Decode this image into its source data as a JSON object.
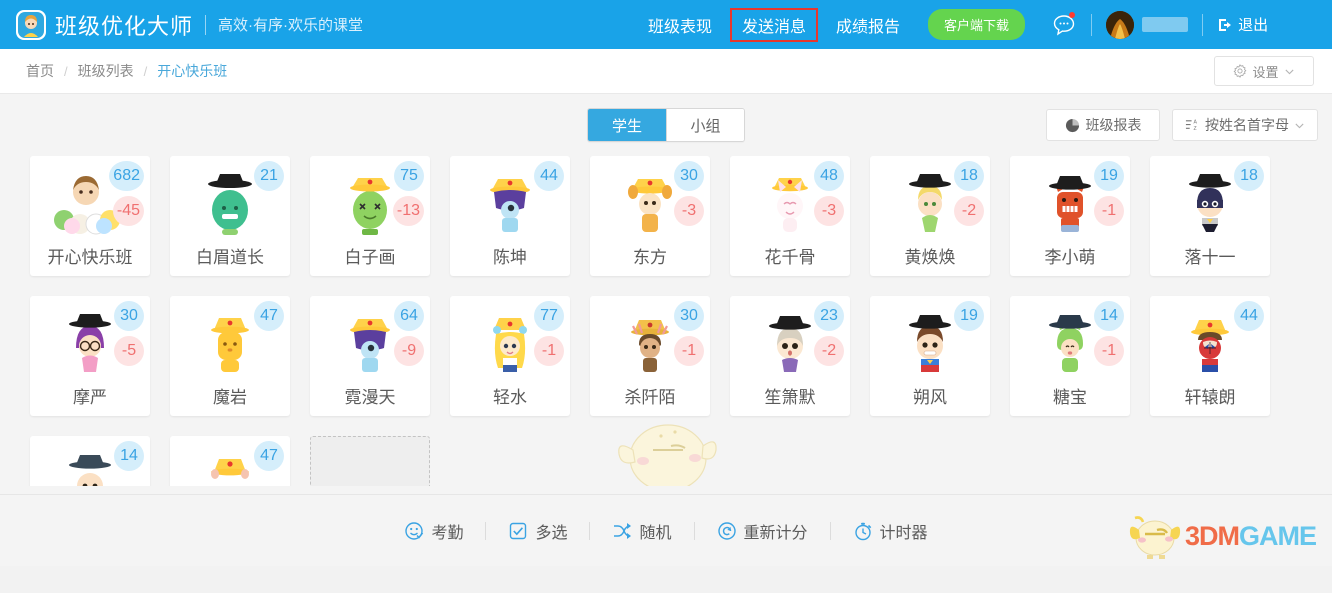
{
  "header": {
    "logo_icon": "app-logo-icon",
    "brand_title": "班级优化大师",
    "brand_subtitle": "高效·有序·欢乐的课堂",
    "nav": [
      {
        "label": "班级表现",
        "highlight": false
      },
      {
        "label": "发送消息",
        "highlight": true
      },
      {
        "label": "成绩报告",
        "highlight": false
      }
    ],
    "download_button": "客户端下载",
    "chat_icon": "chat-bubble-icon",
    "chat_has_unread": true,
    "avatar_icon": "user-avatar",
    "logout_label": "退出",
    "logout_icon": "logout-icon",
    "bg_color": "#19a3e8",
    "highlight_border_color": "#e8372d",
    "download_color": "#64d44e"
  },
  "breadcrumb": {
    "items": [
      "首页",
      "班级列表",
      "开心快乐班"
    ],
    "separator": "/",
    "active_index": 2,
    "active_color": "#4aa8da"
  },
  "settings_button": {
    "label": "设置",
    "icon": "gear-icon",
    "chevron": "chevron-down-icon"
  },
  "tabs": [
    {
      "label": "学生",
      "active": true
    },
    {
      "label": "小组",
      "active": false
    }
  ],
  "report_button": {
    "label": "班级报表",
    "icon": "pie-chart-icon"
  },
  "sort_button": {
    "label": "按姓名首字母",
    "icon": "sort-alpha-icon",
    "chevron": "chevron-down-icon"
  },
  "students": [
    {
      "name": "开心快乐班",
      "positive": "682",
      "negative": "-45",
      "avatar": "group-of-kids"
    },
    {
      "name": "白眉道长",
      "positive": "21",
      "negative": "",
      "avatar": "green-monster-grad"
    },
    {
      "name": "白子画",
      "positive": "75",
      "negative": "-13",
      "avatar": "green-crown-creature"
    },
    {
      "name": "陈坤",
      "positive": "44",
      "negative": "",
      "avatar": "purple-hair-crown"
    },
    {
      "name": "东方",
      "positive": "30",
      "negative": "-3",
      "avatar": "deer-crown"
    },
    {
      "name": "花千骨",
      "positive": "48",
      "negative": "-3",
      "avatar": "pink-cat-crown"
    },
    {
      "name": "黄焕焕",
      "positive": "18",
      "negative": "-2",
      "avatar": "blonde-fairy-grad"
    },
    {
      "name": "李小萌",
      "positive": "19",
      "negative": "-1",
      "avatar": "red-monster-grad"
    },
    {
      "name": "落十一",
      "positive": "18",
      "negative": "",
      "avatar": "batman-grad"
    },
    {
      "name": "摩严",
      "positive": "30",
      "negative": "-5",
      "avatar": "glasses-girl-grad"
    },
    {
      "name": "魔岩",
      "positive": "47",
      "negative": "",
      "avatar": "yellow-cat-crown"
    },
    {
      "name": "霓漫天",
      "positive": "64",
      "negative": "-9",
      "avatar": "purple-hair-crown-blue"
    },
    {
      "name": "轻水",
      "positive": "77",
      "negative": "-1",
      "avatar": "sailor-girl-crown"
    },
    {
      "name": "杀阡陌",
      "positive": "30",
      "negative": "-1",
      "avatar": "brown-hair-crown"
    },
    {
      "name": "笙箫默",
      "positive": "23",
      "negative": "-2",
      "avatar": "white-hair-grad"
    },
    {
      "name": "朔风",
      "positive": "19",
      "negative": "",
      "avatar": "superman-kid-grad"
    },
    {
      "name": "糖宝",
      "positive": "14",
      "negative": "-1",
      "avatar": "green-suit-kid-grad"
    },
    {
      "name": "轩辕朗",
      "positive": "44",
      "negative": "",
      "avatar": "spiderman-crown"
    },
    {
      "name": "",
      "positive": "14",
      "negative": "",
      "avatar": "dark-grad-kid"
    },
    {
      "name": "",
      "positive": "47",
      "negative": "",
      "avatar": "gold-crown-kid"
    }
  ],
  "placeholder_card": {
    "label": ""
  },
  "bottom_tools": [
    {
      "label": "考勤",
      "icon": "smiley-check-icon"
    },
    {
      "label": "多选",
      "icon": "checkbox-icon"
    },
    {
      "label": "随机",
      "icon": "shuffle-icon"
    },
    {
      "label": "重新计分",
      "icon": "refresh-icon"
    },
    {
      "label": "计时器",
      "icon": "timer-icon"
    }
  ],
  "watermark": {
    "text_primary": "3DM",
    "text_secondary": "GAME",
    "icon": "chick-mascot"
  },
  "colors": {
    "positive_badge_bg": "#d5eefb",
    "positive_badge_text": "#3aa3e3",
    "negative_badge_bg": "#fde3e3",
    "negative_badge_text": "#f07070",
    "page_bg": "#f4f4f4"
  }
}
